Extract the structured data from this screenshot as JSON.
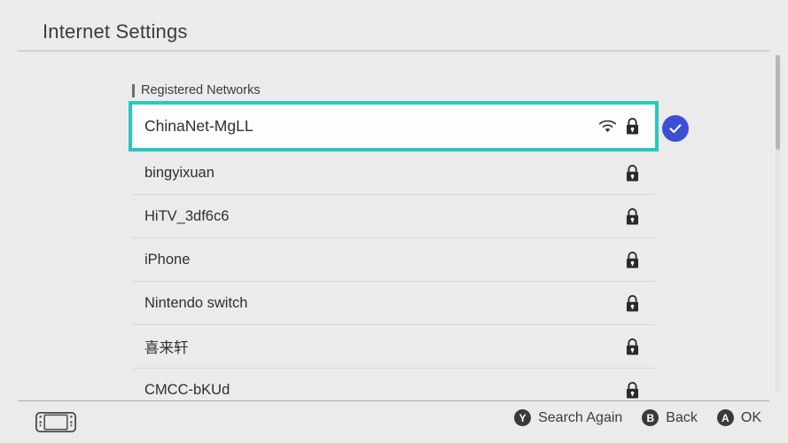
{
  "header": {
    "title": "Internet Settings"
  },
  "section": {
    "label": "Registered Networks",
    "marker_icon": "section-marker-bar"
  },
  "colors": {
    "background": "#ebebeb",
    "selection_border": "#29c8bf",
    "check_badge": "#3b4fd4",
    "text": "#2f2f2f",
    "divider": "#d7d7d7"
  },
  "networks": [
    {
      "ssid": "ChinaNet-MgLL",
      "selected": true,
      "connected": true,
      "signal_icon": "wifi-icon",
      "secured_icon": "lock-icon",
      "check_icon": "check-circle-icon"
    },
    {
      "ssid": "bingyixuan",
      "selected": false,
      "connected": false,
      "secured_icon": "lock-icon"
    },
    {
      "ssid": "HiTV_3df6c6",
      "selected": false,
      "connected": false,
      "secured_icon": "lock-icon"
    },
    {
      "ssid": "iPhone",
      "selected": false,
      "connected": false,
      "secured_icon": "lock-icon"
    },
    {
      "ssid": "Nintendo switch",
      "selected": false,
      "connected": false,
      "secured_icon": "lock-icon"
    },
    {
      "ssid": "喜来轩",
      "selected": false,
      "connected": false,
      "secured_icon": "lock-icon"
    },
    {
      "ssid": "CMCC-bKUd",
      "selected": false,
      "connected": false,
      "secured_icon": "lock-icon"
    }
  ],
  "footer": {
    "console_icon": "switch-handheld-icon",
    "hints": [
      {
        "button": "Y",
        "label": "Search Again"
      },
      {
        "button": "B",
        "label": "Back"
      },
      {
        "button": "A",
        "label": "OK"
      }
    ]
  },
  "scrollbar": {
    "orientation": "vertical",
    "position": "top"
  }
}
